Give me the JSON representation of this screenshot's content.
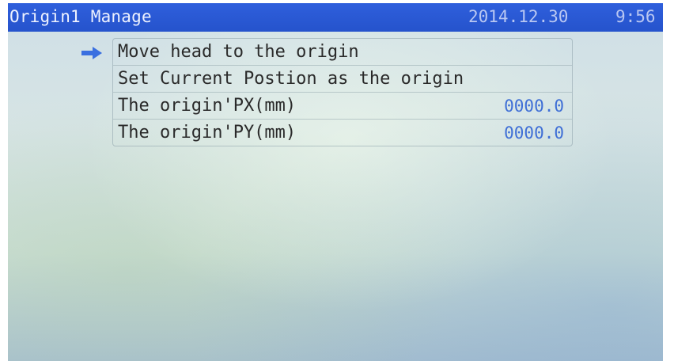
{
  "header": {
    "title": "Origin1 Manage",
    "date": "2014.12.30",
    "time": "9:56"
  },
  "menu": {
    "selected_index": 0,
    "pointer_icon": "arrow-right-icon",
    "items": [
      {
        "label": "Move head to the origin",
        "value": ""
      },
      {
        "label": "Set Current Postion as the origin",
        "value": ""
      },
      {
        "label": "The origin'PX(mm)",
        "value": "0000.0"
      },
      {
        "label": "The origin'PY(mm)",
        "value": "0000.0"
      }
    ]
  },
  "colors": {
    "title_bar": "#2553cc",
    "value_text": "#3f6fd6",
    "pointer": "#3a6fe0"
  }
}
